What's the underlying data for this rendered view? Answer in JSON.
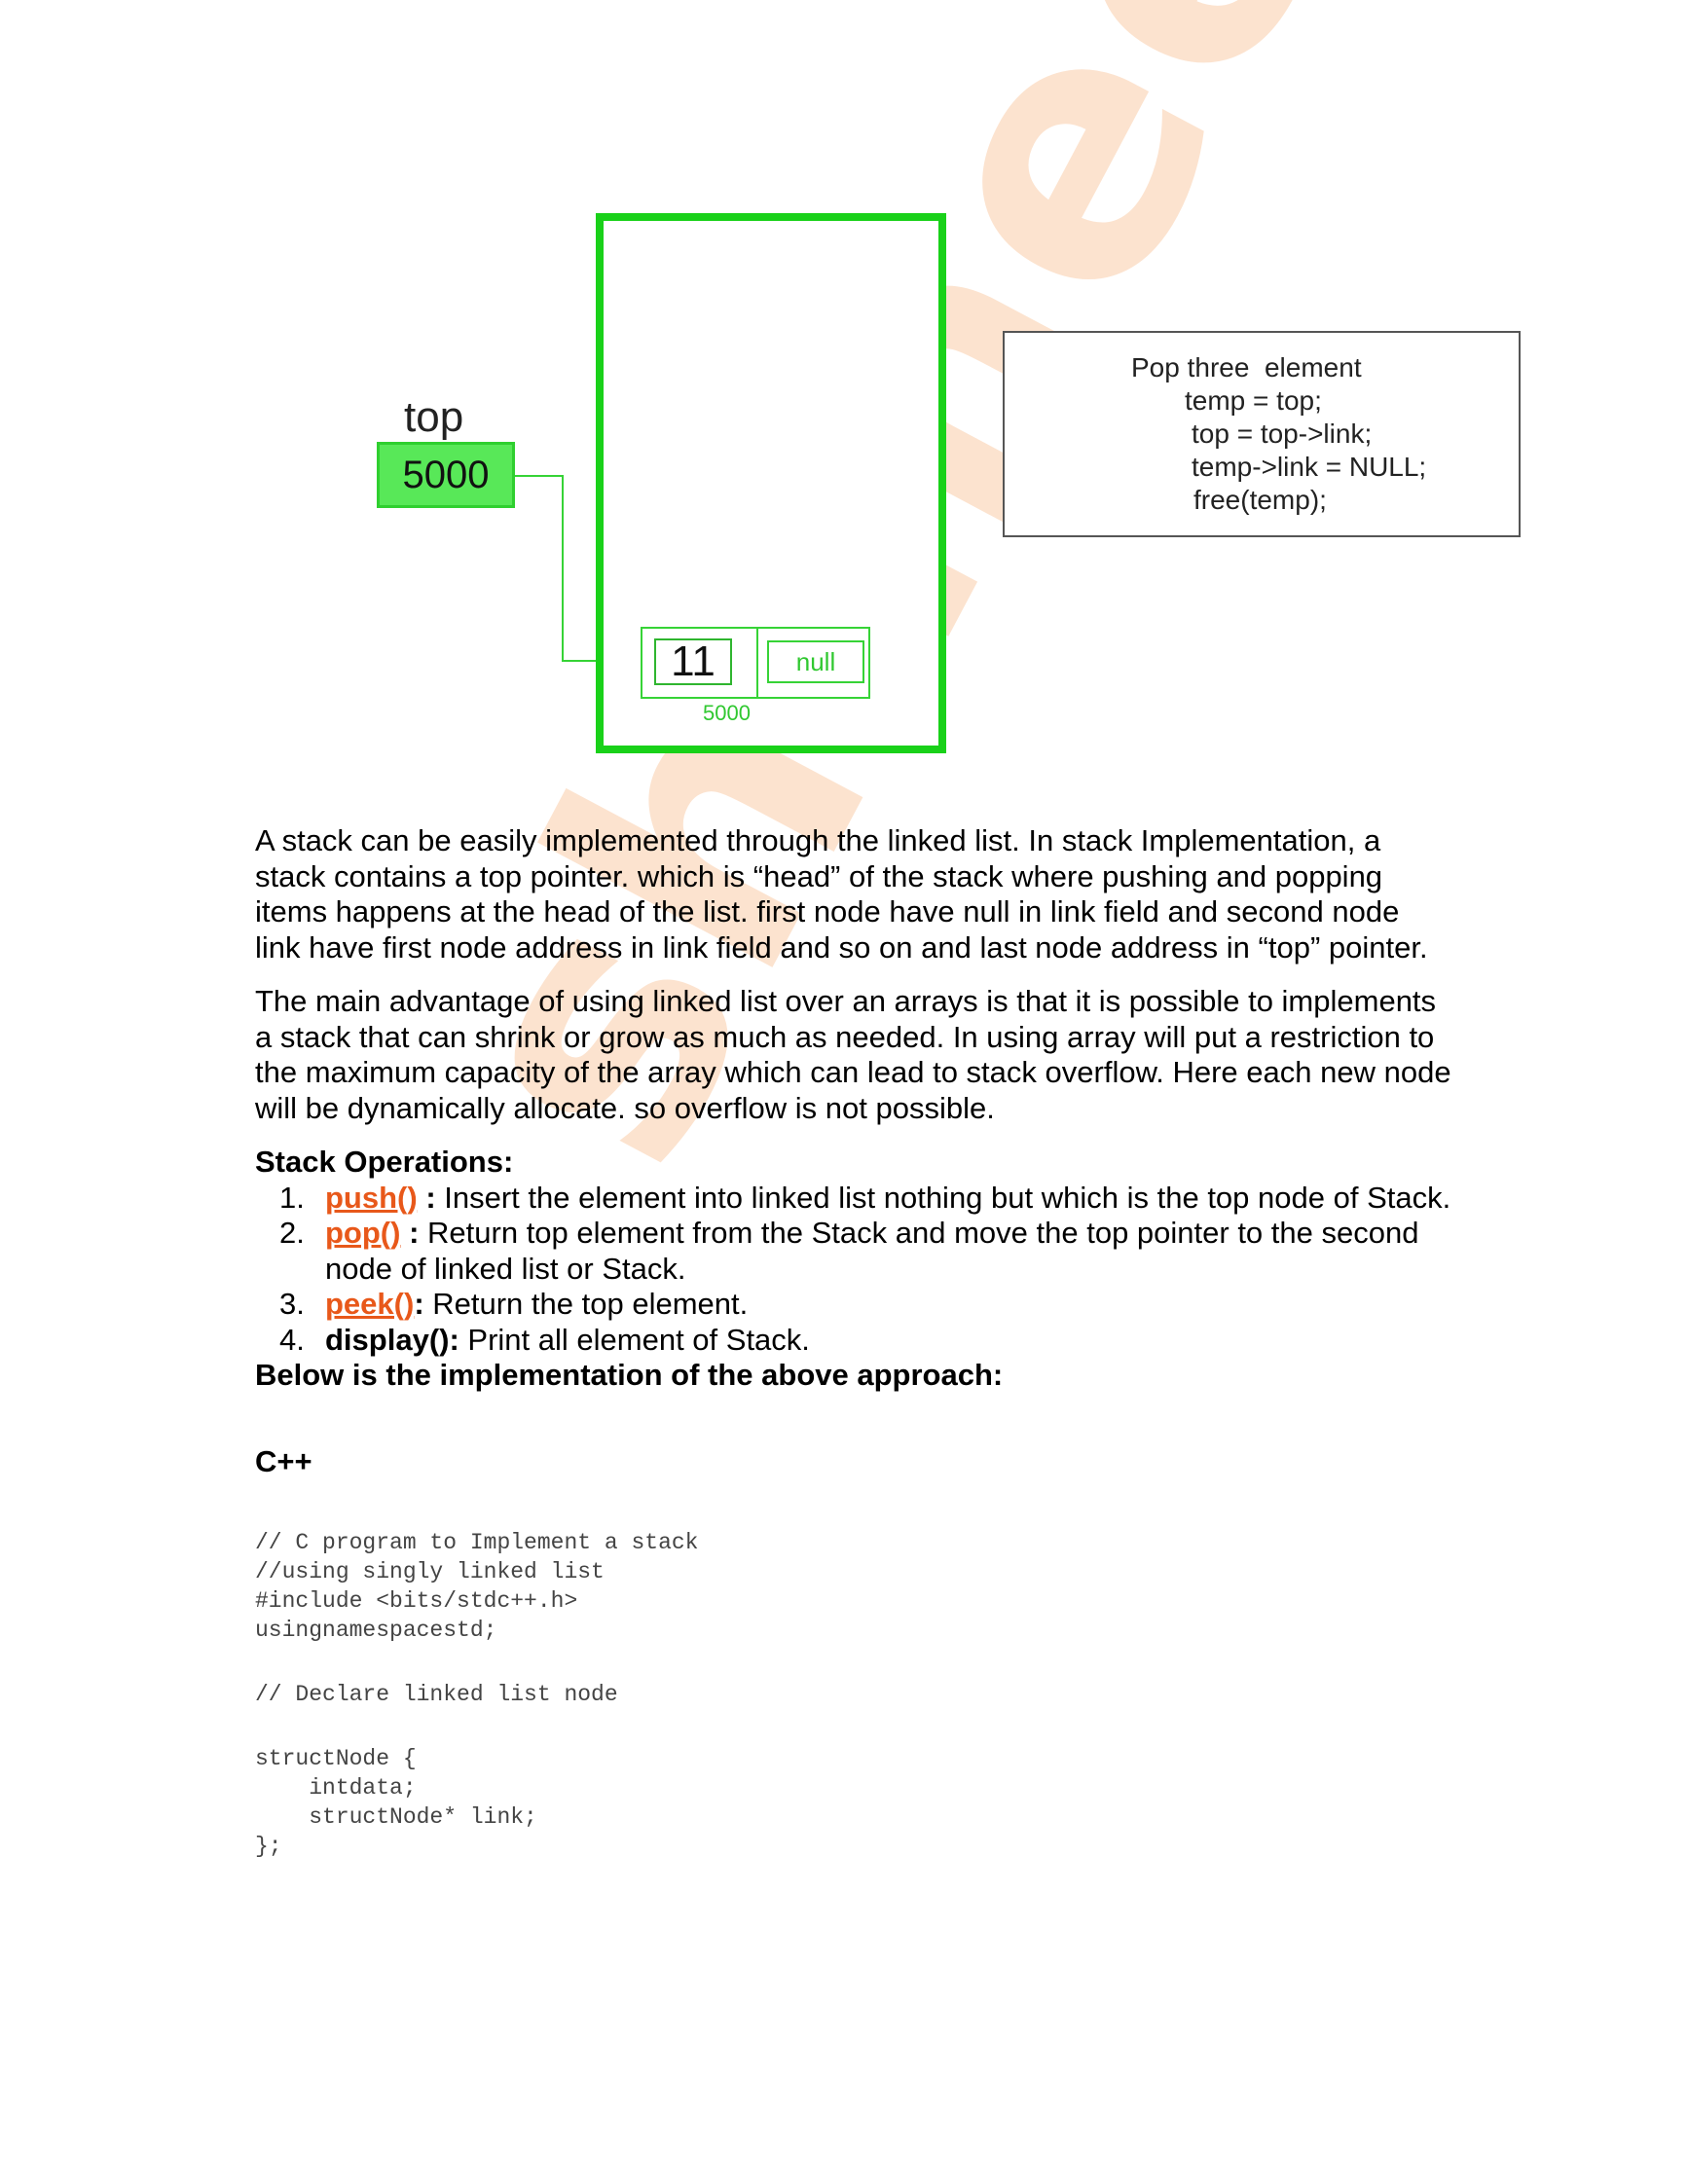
{
  "watermark": "shanee",
  "diagram": {
    "top_label": "top",
    "top_value": "5000",
    "node_data": "11",
    "node_link": "null",
    "node_address": "5000",
    "code_note": {
      "title": "Pop three  element",
      "lines": [
        "temp = top;",
        "top = top->link;",
        "temp->link = NULL;",
        "free(temp);"
      ]
    },
    "colors": {
      "green_fill": "#58e858",
      "green_border": "#19d119"
    }
  },
  "paragraphs": [
    "A stack can be easily implemented through the linked list. In stack Implementation, a stack contains a top pointer. which is “head” of the stack where pushing and popping items happens at the head of the list. first node have null in link field and second node link have first node address in link field and so on and last node address in “top” pointer.",
    "The main advantage of using linked list over an arrays is that it is possible to implements a stack that can shrink or grow as much as needed. In using array will put a restriction to the maximum capacity of the array which can lead to stack overflow. Here each new node will be dynamically allocate. so overflow is not possible."
  ],
  "operations": {
    "heading": "Stack Operations:",
    "items": [
      {
        "num": "1.",
        "name": "push()",
        "sep": " : ",
        "desc": "Insert the element into linked list nothing but which is the top node of Stack."
      },
      {
        "num": "2.",
        "name": "pop()",
        "sep": " : ",
        "desc": "Return top element from the Stack and move the top pointer to the second node of linked list or Stack."
      },
      {
        "num": "3.",
        "name": "peek()",
        "sep": ": ",
        "desc": "Return the top element."
      },
      {
        "num": "4.",
        "name": "display():",
        "sep": " ",
        "desc": "Print all element of Stack."
      }
    ],
    "implementation_heading": "Below is the implementation of the above approach:"
  },
  "language": "C++",
  "code_blocks": [
    "// C program to Implement a stack\n//using singly linked list\n#include <bits/stdc++.h>\nusingnamespacestd;",
    "// Declare linked list node",
    "structNode {\n    intdata;\n    structNode* link;\n};"
  ],
  "accent_color": "#e8581a"
}
